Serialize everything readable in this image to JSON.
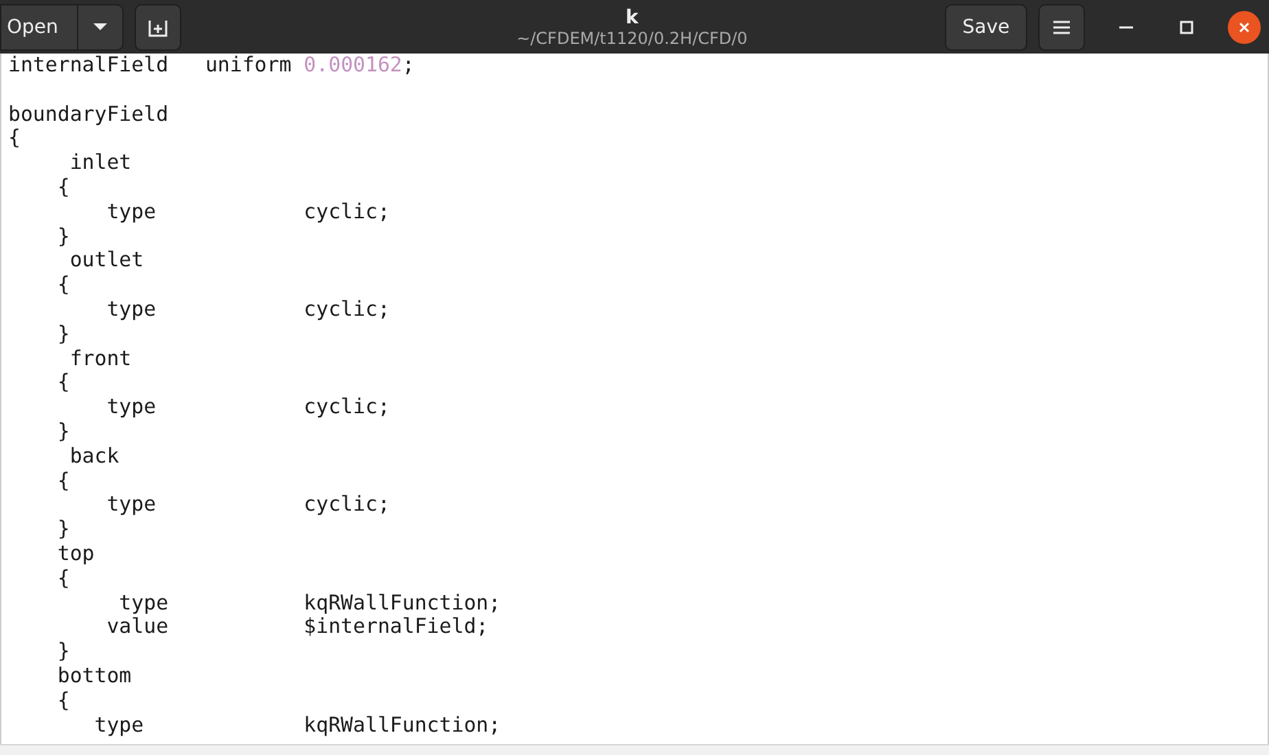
{
  "header": {
    "open_label": "Open",
    "title": "k",
    "subtitle": "~/CFDEM/t1120/0.2H/CFD/0",
    "save_label": "Save"
  },
  "editor": {
    "lines": [
      {
        "segments": [
          {
            "kind": "code",
            "text": "internalField   uniform "
          },
          {
            "kind": "number",
            "text": "0.000162"
          },
          {
            "kind": "code",
            "text": ";"
          }
        ]
      },
      {
        "gap_before": true,
        "segments": [
          {
            "kind": "code",
            "text": "boundaryField"
          }
        ]
      },
      {
        "segments": [
          {
            "kind": "code",
            "text": "{"
          }
        ]
      },
      {
        "segments": [
          {
            "kind": "code",
            "text": "     inlet"
          }
        ]
      },
      {
        "segments": [
          {
            "kind": "code",
            "text": "    {"
          }
        ]
      },
      {
        "segments": [
          {
            "kind": "code",
            "text": "        type            cyclic;"
          }
        ]
      },
      {
        "segments": [
          {
            "kind": "code",
            "text": "    }"
          }
        ]
      },
      {
        "segments": [
          {
            "kind": "code",
            "text": "     outlet"
          }
        ]
      },
      {
        "segments": [
          {
            "kind": "code",
            "text": "    {"
          }
        ]
      },
      {
        "segments": [
          {
            "kind": "code",
            "text": "        type            cyclic;"
          }
        ]
      },
      {
        "segments": [
          {
            "kind": "code",
            "text": "    }"
          }
        ]
      },
      {
        "segments": [
          {
            "kind": "code",
            "text": "     front"
          }
        ]
      },
      {
        "segments": [
          {
            "kind": "code",
            "text": "    {"
          }
        ]
      },
      {
        "segments": [
          {
            "kind": "code",
            "text": "        type            cyclic;"
          }
        ]
      },
      {
        "segments": [
          {
            "kind": "code",
            "text": "    }"
          }
        ]
      },
      {
        "segments": [
          {
            "kind": "code",
            "text": "     back"
          }
        ]
      },
      {
        "segments": [
          {
            "kind": "code",
            "text": "    {"
          }
        ]
      },
      {
        "segments": [
          {
            "kind": "code",
            "text": "        type            cyclic;"
          }
        ]
      },
      {
        "segments": [
          {
            "kind": "code",
            "text": "    }"
          }
        ]
      },
      {
        "segments": [
          {
            "kind": "code",
            "text": "    top"
          }
        ]
      },
      {
        "segments": [
          {
            "kind": "code",
            "text": "    {"
          }
        ]
      },
      {
        "segments": [
          {
            "kind": "code",
            "text": "         type           kqRWallFunction;"
          }
        ]
      },
      {
        "segments": [
          {
            "kind": "code",
            "text": "        value           $internalField;"
          }
        ]
      },
      {
        "segments": [
          {
            "kind": "code",
            "text": "    }"
          }
        ]
      },
      {
        "segments": [
          {
            "kind": "code",
            "text": "    bottom"
          }
        ]
      },
      {
        "segments": [
          {
            "kind": "code",
            "text": "    {"
          }
        ]
      },
      {
        "segments": [
          {
            "kind": "code",
            "text": "       type             kqRWallFunction;"
          }
        ]
      }
    ]
  }
}
